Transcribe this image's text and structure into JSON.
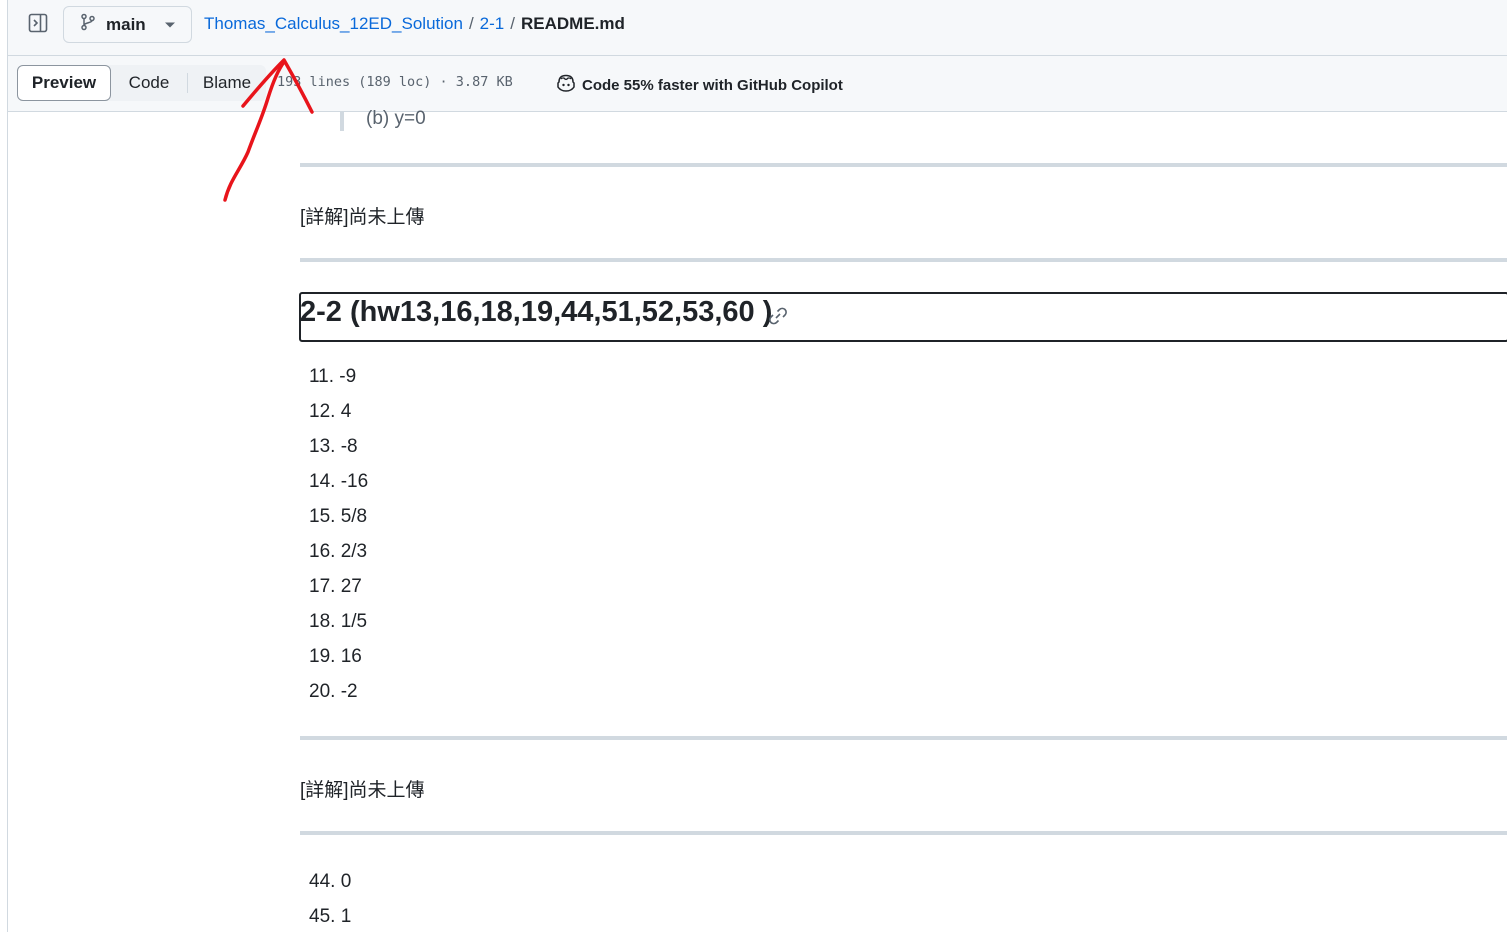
{
  "header": {
    "branch": "main",
    "breadcrumb": {
      "repo": "Thomas_Calculus_12ED_Solution",
      "folder": "2-1",
      "file": "README.md",
      "separator": "/"
    }
  },
  "toolbar": {
    "tabs": [
      "Preview",
      "Code",
      "Blame"
    ],
    "file_meta": "193 lines (189 loc) · 3.87 KB",
    "copilot_label": "Code 55% faster with GitHub Copilot"
  },
  "content": {
    "quote_line": "(b) y=0",
    "detail_note_1": "[詳解]尚未上傳",
    "section_heading": "2-2 (hw13,16,18,19,44,51,52,53,60 )",
    "answers_1": [
      "11. -9",
      "12. 4",
      "13. -8",
      "14. -16",
      "15. 5/8",
      "16. 2/3",
      "17. 27",
      "18. 1/5",
      "19. 16",
      "20. -2"
    ],
    "detail_note_2": "[詳解]尚未上傳",
    "answers_2": [
      "44. 0",
      "45. 1"
    ]
  },
  "colors": {
    "link": "#0969da",
    "annotation": "#e8141b",
    "rule": "#d1d9e0"
  }
}
